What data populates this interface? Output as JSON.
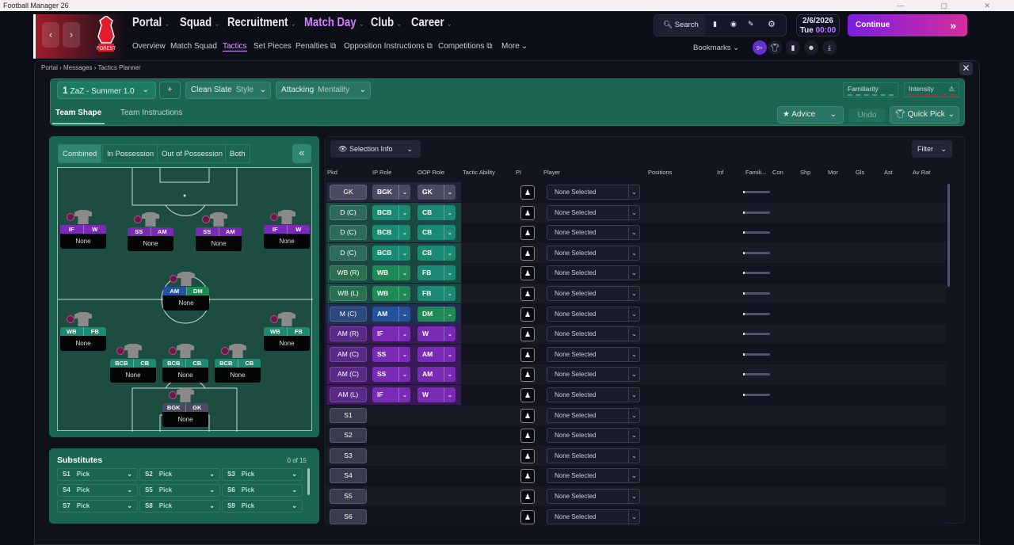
{
  "window": {
    "title": "Football Manager 26"
  },
  "nav": {
    "main": [
      "Portal",
      "Squad",
      "Recruitment",
      "Match Day",
      "Club",
      "Career"
    ],
    "active_main": "Match Day",
    "sub": [
      "Overview",
      "Match Squad",
      "Tactics",
      "Set Pieces",
      "Penalties",
      "Opposition Instructions",
      "Competitions",
      "More"
    ],
    "active_sub": "Tactics",
    "search": "Search",
    "date": "2/6/2026",
    "day": "Tue",
    "time": "00:00",
    "continue": "Continue",
    "bookmarks": "Bookmarks",
    "notification_badge": "9+",
    "club_crest_text": "FOREST"
  },
  "breadcrumb": [
    "Portal",
    "Messages",
    "Tactics Planner"
  ],
  "toolbar": {
    "tactic_number": "1",
    "tactic_name": "ZaZ - Summer 1.0",
    "add": "+",
    "style_value": "Clean Slate",
    "style_label": "Style",
    "mentality_value": "Attacking",
    "mentality_label": "Mentality",
    "familiarity": "Familiarity",
    "intensity": "Intensity",
    "advice": "Advice",
    "undo": "Undo",
    "quick_pick": "Quick Pick",
    "tabs": [
      "Team Shape",
      "Team Instructions"
    ]
  },
  "pitch": {
    "segments": [
      "Combined",
      "In Possession",
      "Out of Possession",
      "Both"
    ],
    "active_segment": "Combined",
    "players": [
      {
        "ip": "IF",
        "oop": "W",
        "name": "None",
        "c1": "#7a2bb5",
        "c2": "#7a2bb5"
      },
      {
        "ip": "SS",
        "oop": "AM",
        "name": "None",
        "c1": "#7a2bb5",
        "c2": "#7a2bb5"
      },
      {
        "ip": "SS",
        "oop": "AM",
        "name": "None",
        "c1": "#7a2bb5",
        "c2": "#7a2bb5"
      },
      {
        "ip": "IF",
        "oop": "W",
        "name": "None",
        "c1": "#7a2bb5",
        "c2": "#7a2bb5"
      },
      {
        "ip": "AM",
        "oop": "DM",
        "name": "None",
        "c1": "#23539a",
        "c2": "#1f8a55"
      },
      {
        "ip": "WB",
        "oop": "FB",
        "name": "None",
        "c1": "#1a8a72",
        "c2": "#1a8a72"
      },
      {
        "ip": "WB",
        "oop": "FB",
        "name": "None",
        "c1": "#1a8a72",
        "c2": "#1a8a72"
      },
      {
        "ip": "BCB",
        "oop": "CB",
        "name": "None",
        "c1": "#1a8a72",
        "c2": "#1a8a72"
      },
      {
        "ip": "BCB",
        "oop": "CB",
        "name": "None",
        "c1": "#1a8a72",
        "c2": "#1a8a72"
      },
      {
        "ip": "BCB",
        "oop": "CB",
        "name": "None",
        "c1": "#1a8a72",
        "c2": "#1a8a72"
      },
      {
        "ip": "BGK",
        "oop": "GK",
        "name": "None",
        "c1": "#4a4a62",
        "c2": "#4a4a62"
      }
    ]
  },
  "substitutes": {
    "title": "Substitutes",
    "count": "0 of 15",
    "slots": [
      [
        "S1",
        "Pick"
      ],
      [
        "S2",
        "Pick"
      ],
      [
        "S3",
        "Pick"
      ],
      [
        "S4",
        "Pick"
      ],
      [
        "S5",
        "Pick"
      ],
      [
        "S6",
        "Pick"
      ],
      [
        "S7",
        "Pick"
      ],
      [
        "S8",
        "Pick"
      ],
      [
        "S9",
        "Pick"
      ]
    ]
  },
  "table": {
    "selection_info": "Selection Info",
    "filter": "Filter",
    "columns": [
      "Pkd",
      "IP Role",
      "OOP Role",
      "Tactic Ability",
      "PI",
      "Player",
      "Positions",
      "Inf",
      "Famili...",
      "Con",
      "Shp",
      "Mor",
      "Gls",
      "Ast",
      "Av Rat"
    ],
    "rows": [
      {
        "pkd": "GK",
        "ip": "BGK",
        "oop": "GK",
        "player": "None Selected",
        "group": "gk"
      },
      {
        "pkd": "D (C)",
        "ip": "BCB",
        "oop": "CB",
        "player": "None Selected",
        "group": "d"
      },
      {
        "pkd": "D (C)",
        "ip": "BCB",
        "oop": "CB",
        "player": "None Selected",
        "group": "d"
      },
      {
        "pkd": "D (C)",
        "ip": "BCB",
        "oop": "CB",
        "player": "None Selected",
        "group": "d"
      },
      {
        "pkd": "WB (R)",
        "ip": "WB",
        "oop": "FB",
        "player": "None Selected",
        "group": "wb"
      },
      {
        "pkd": "WB (L)",
        "ip": "WB",
        "oop": "FB",
        "player": "None Selected",
        "group": "wb"
      },
      {
        "pkd": "M (C)",
        "ip": "AM",
        "oop": "DM",
        "player": "None Selected",
        "group": "m"
      },
      {
        "pkd": "AM (R)",
        "ip": "IF",
        "oop": "W",
        "player": "None Selected",
        "group": "am"
      },
      {
        "pkd": "AM (C)",
        "ip": "SS",
        "oop": "AM",
        "player": "None Selected",
        "group": "am"
      },
      {
        "pkd": "AM (C)",
        "ip": "SS",
        "oop": "AM",
        "player": "None Selected",
        "group": "am"
      },
      {
        "pkd": "AM (L)",
        "ip": "IF",
        "oop": "W",
        "player": "None Selected",
        "group": "am"
      },
      {
        "pkd": "S1",
        "player": "None Selected",
        "group": "s"
      },
      {
        "pkd": "S2",
        "player": "None Selected",
        "group": "s"
      },
      {
        "pkd": "S3",
        "player": "None Selected",
        "group": "s"
      },
      {
        "pkd": "S4",
        "player": "None Selected",
        "group": "s"
      },
      {
        "pkd": "S5",
        "player": "None Selected",
        "group": "s"
      },
      {
        "pkd": "S6",
        "player": "None Selected",
        "group": "s"
      }
    ]
  },
  "colors": {
    "accent": "#b44cff",
    "continue_start": "#7b1fe0",
    "continue_end": "#d52d9c",
    "tactic_green": "#1b6653",
    "pitch": "#1c4d40",
    "attack_purple": "#7a2bb5",
    "defense_teal": "#1a8a72",
    "midfield_blue": "#23539a"
  }
}
